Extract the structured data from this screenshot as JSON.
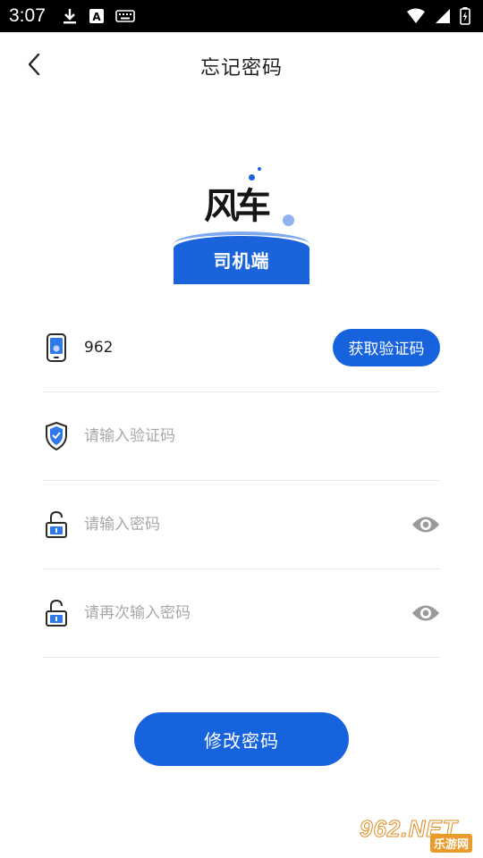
{
  "status_bar": {
    "time": "3:07",
    "notification_icons": [
      "download-icon",
      "text-a-icon",
      "keyboard-icon"
    ],
    "system_icons": [
      "wifi-icon",
      "signal-icon",
      "battery-icon"
    ]
  },
  "header": {
    "back_icon": "chevron-left-icon",
    "title": "忘记密码"
  },
  "logo": {
    "brand": "风车",
    "subtitle": "司机端",
    "colors": {
      "primary": "#1a63db",
      "light": "#7ea8ef"
    }
  },
  "form": {
    "phone": {
      "icon": "phone-icon",
      "value": "962",
      "placeholder": ""
    },
    "get_code_label": "获取验证码",
    "code": {
      "icon": "verify-shield-icon",
      "value": "",
      "placeholder": "请输入验证码"
    },
    "password": {
      "icon": "unlock-icon",
      "value": "",
      "placeholder": "请输入密码",
      "toggle_icon": "eye-icon"
    },
    "password_confirm": {
      "icon": "unlock-icon",
      "value": "",
      "placeholder": "请再次输入密码",
      "toggle_icon": "eye-icon"
    }
  },
  "submit_label": "修改密码",
  "watermark": {
    "top": "962.NET",
    "bottom": "乐游网"
  },
  "colors": {
    "accent": "#1763de",
    "divider": "#e6e6e6",
    "placeholder": "#a8a8a8"
  }
}
